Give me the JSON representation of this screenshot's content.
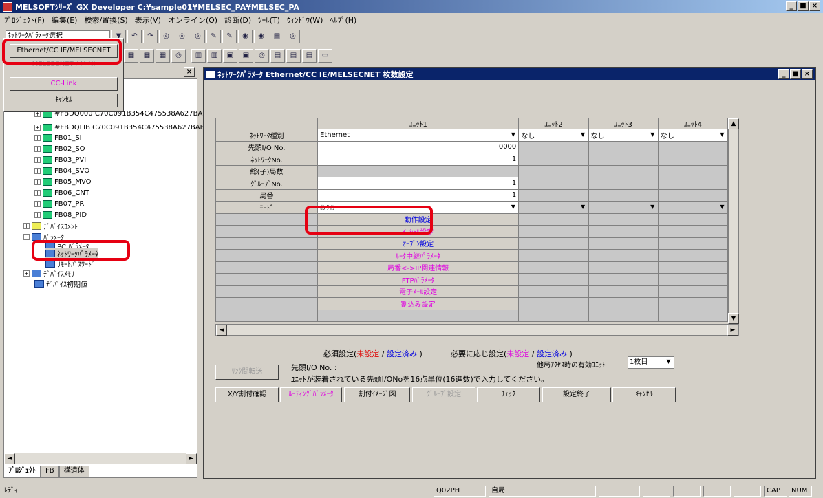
{
  "window": {
    "title": "MELSOFTｼﾘｰｽﾞ GX Developer C:¥sample01¥MELSEC_PA¥MELSEC_PA",
    "btn_min": "_",
    "btn_max": "■",
    "btn_close": "×"
  },
  "menu": [
    "ﾌﾟﾛｼﾞｪｸﾄ(F)",
    "編集(E)",
    "検索/置換(S)",
    "表示(V)",
    "オンライン(O)",
    "診断(D)",
    "ﾂｰﾙ(T)",
    "ｳｨﾝﾄﾞｳ(W)",
    "ﾍﾙﾌﾟ(H)"
  ],
  "toolbar": {
    "combo_value": "ﾈｯﾄﾜｰｸﾊﾟﾗﾒｰﾀ選択"
  },
  "popup": {
    "items": [
      "Ethernet/CC IE/MELSECNET",
      "MELSECNET / MINI",
      "CC-Link",
      "ｷｬﾝｾﾙ"
    ]
  },
  "tree": {
    "items": [
      "#FBDQ000 C70C091B354C475538A627BAE",
      "#FBDQLIB C70C091B354C475538A627BAB",
      "FB01_SI",
      "FB02_SO",
      "FB03_PVI",
      "FB04_SVO",
      "FB05_MVO",
      "FB06_CNT",
      "FB07_PR",
      "FB08_PID",
      "ﾃﾞﾊﾞｲｽｺﾒﾝﾄ",
      "ﾊﾟﾗﾒｰﾀ",
      "PC ﾊﾟﾗﾒｰﾀ",
      "ﾈｯﾄﾜｰｸﾊﾟﾗﾒｰﾀ",
      "ﾘﾓｰﾄﾊﾟｽﾜｰﾄﾞ",
      "ﾃﾞﾊﾞｲｽﾒﾓﾘ",
      "ﾃﾞﾊﾞｲｽ初期値"
    ],
    "tabs": [
      "ﾌﾟﾛｼﾞｪｸﾄ",
      "FB",
      "構造体"
    ]
  },
  "dialog": {
    "title": "ﾈｯﾄﾜｰｸﾊﾟﾗﾒｰﾀ Ethernet/CC IE/MELSECNET 枚数設定",
    "columns": [
      "ﾕﾆｯﾄ1",
      "ﾕﾆｯﾄ2",
      "ﾕﾆｯﾄ3",
      "ﾕﾆｯﾄ4"
    ],
    "rows": {
      "net_type": "ﾈｯﾄﾜｰｸ種別",
      "head_io": "先頭I/O No.",
      "net_no": "ﾈｯﾄﾜｰｸNo.",
      "stations": "総(子)局数",
      "group_no": "ｸﾞﾙｰﾌﾟNo.",
      "station_no": "局番",
      "mode": "ﾓｰﾄﾞ"
    },
    "values": {
      "unit1_type": "Ethernet",
      "unit_other_type": "なし",
      "unit1_head_io": "0000",
      "unit1_net_no": "1",
      "unit1_group_no": "1",
      "unit1_station_no": "1",
      "unit1_mode": "ｵﾝﾗｲﾝ"
    },
    "settings": [
      {
        "label": "動作設定",
        "color": "blue"
      },
      {
        "label": "ｲﾆｼｬﾙ設定",
        "color": "mag"
      },
      {
        "label": "ｵｰﾌﾟﾝ設定",
        "color": "blue"
      },
      {
        "label": "ﾙｰﾀ中継ﾊﾟﾗﾒｰﾀ",
        "color": "mag"
      },
      {
        "label": "局番<->IP関連情報",
        "color": "mag"
      },
      {
        "label": "FTPﾊﾟﾗﾒｰﾀ",
        "color": "mag"
      },
      {
        "label": "電子ﾒｰﾙ設定",
        "color": "mag"
      },
      {
        "label": "割込み設定",
        "color": "mag"
      }
    ],
    "legend": {
      "required": "必須設定(",
      "unset": "未設定",
      "slash": " / ",
      "set": "設定済み",
      "close": " )",
      "optional": "必要に応じ設定(",
      "unset2": "未設定",
      "set2": "設定済み"
    },
    "valid_unit_label": "他局ｱｸｾｽ時の有効ﾕﾆｯﾄ",
    "valid_unit_value": "1枚目",
    "link_transfer_btn": "ﾘﾝｸ間転送",
    "head_io_label": "先頭I/O No. :",
    "hint": "ﾕﾆｯﾄが装着されている先頭I/ONoを16点単位(16進数)で入力してください。",
    "buttons": [
      "X/Y割付確認",
      "ﾙｰﾃｨﾝｸﾞﾊﾟﾗﾒｰﾀ",
      "割付ｲﾒｰｼﾞ図",
      "ｸﾞﾙｰﾌﾟ設定",
      "ﾁｪｯｸ",
      "設定終了",
      "ｷｬﾝｾﾙ"
    ]
  },
  "status": {
    "ready": "ﾚﾃﾞｨ",
    "cpu": "Q02PH",
    "station": "自局",
    "cap": "CAP",
    "num": "NUM"
  }
}
